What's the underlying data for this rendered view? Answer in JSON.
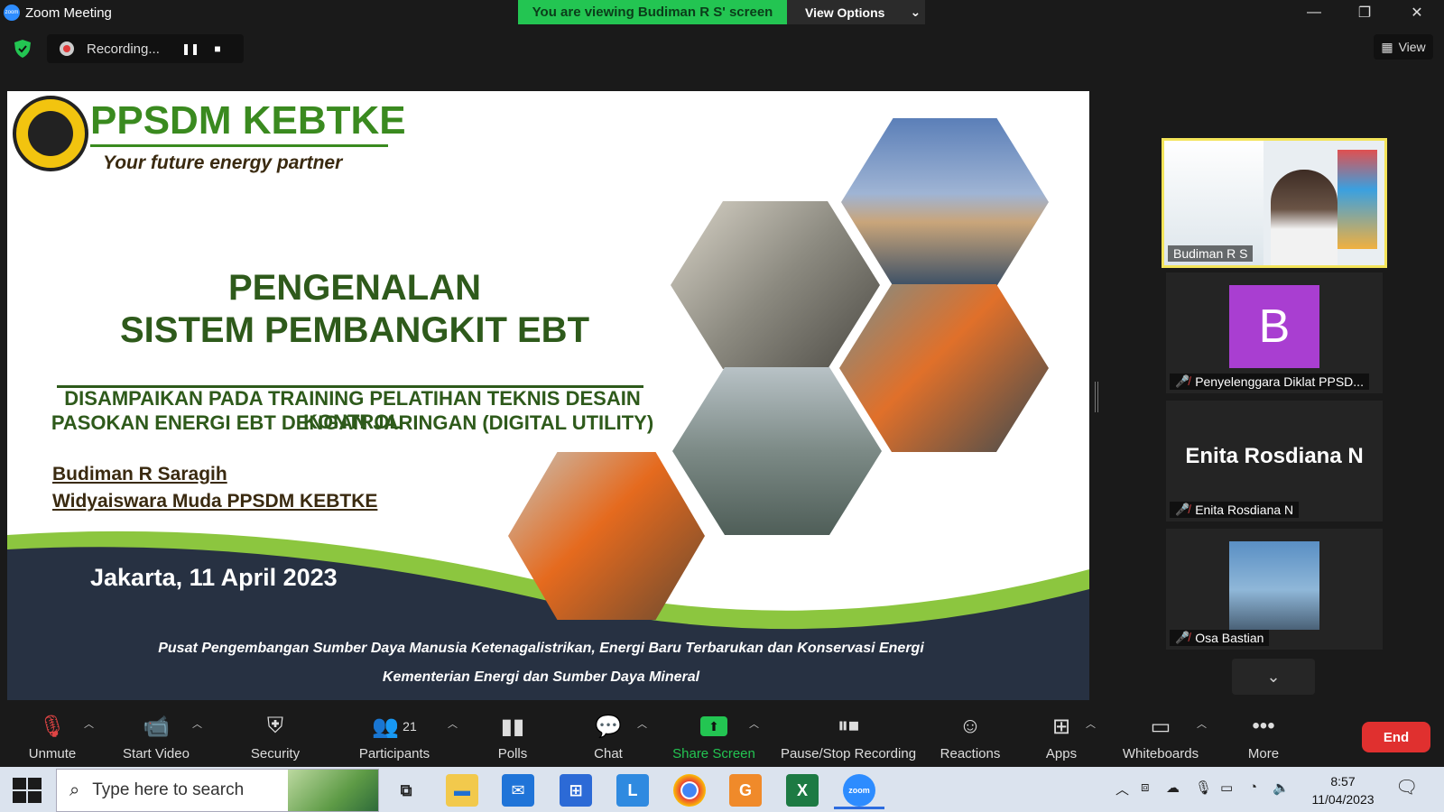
{
  "window": {
    "title": "Zoom Meeting",
    "banner": "You are viewing Budiman R S' screen",
    "view_options": "View Options",
    "view_button": "View"
  },
  "recording": {
    "status": "Recording..."
  },
  "slide": {
    "brand": "PPSDM KEBTKE",
    "tagline": "Your future energy partner",
    "title_line1": "PENGENALAN",
    "title_line2": "SISTEM PEMBANGKIT EBT",
    "subtitle_line1": "DISAMPAIKAN PADA TRAINING PELATIHAN TEKNIS DESAIN KONTROL",
    "subtitle_line2": "PASOKAN ENERGI EBT DENGAN JARINGAN (DIGITAL UTILITY)",
    "presenter": "Budiman R Saragih",
    "role": "Widyaiswara Muda PPSDM KEBTKE",
    "date": "Jakarta, 11 April 2023",
    "footer_line1": "Pusat Pengembangan Sumber Daya Manusia Ketenagalistrikan, Energi Baru Terbarukan dan Konservasi Energi",
    "footer_line2": "Kementerian Energi dan Sumber Daya Mineral",
    "colors": {
      "brand_green": "#3a8a1f",
      "dark_green": "#2e5a1b",
      "navy_band": "#273142",
      "lime_wave": "#8cc63f"
    }
  },
  "gallery": {
    "participants": [
      {
        "name": "Budiman R S",
        "muted": false,
        "active_speaker": true
      },
      {
        "name": "Penyelenggara Diklat PPSD...",
        "avatar_letter": "B",
        "muted": true
      },
      {
        "name": "Enita Rosdiana N",
        "display_name": "Enita Rosdiana N",
        "muted": true
      },
      {
        "name": "Osa Bastian",
        "muted": true
      }
    ]
  },
  "toolbar": {
    "unmute": "Unmute",
    "start_video": "Start Video",
    "security": "Security",
    "participants": "Participants",
    "participants_count": "21",
    "polls": "Polls",
    "chat": "Chat",
    "share_screen": "Share Screen",
    "pause_stop_recording": "Pause/Stop Recording",
    "reactions": "Reactions",
    "apps": "Apps",
    "whiteboards": "Whiteboards",
    "more": "More",
    "end": "End"
  },
  "taskbar": {
    "search_placeholder": "Type here to search",
    "time": "8:57",
    "date": "11/04/2023"
  }
}
